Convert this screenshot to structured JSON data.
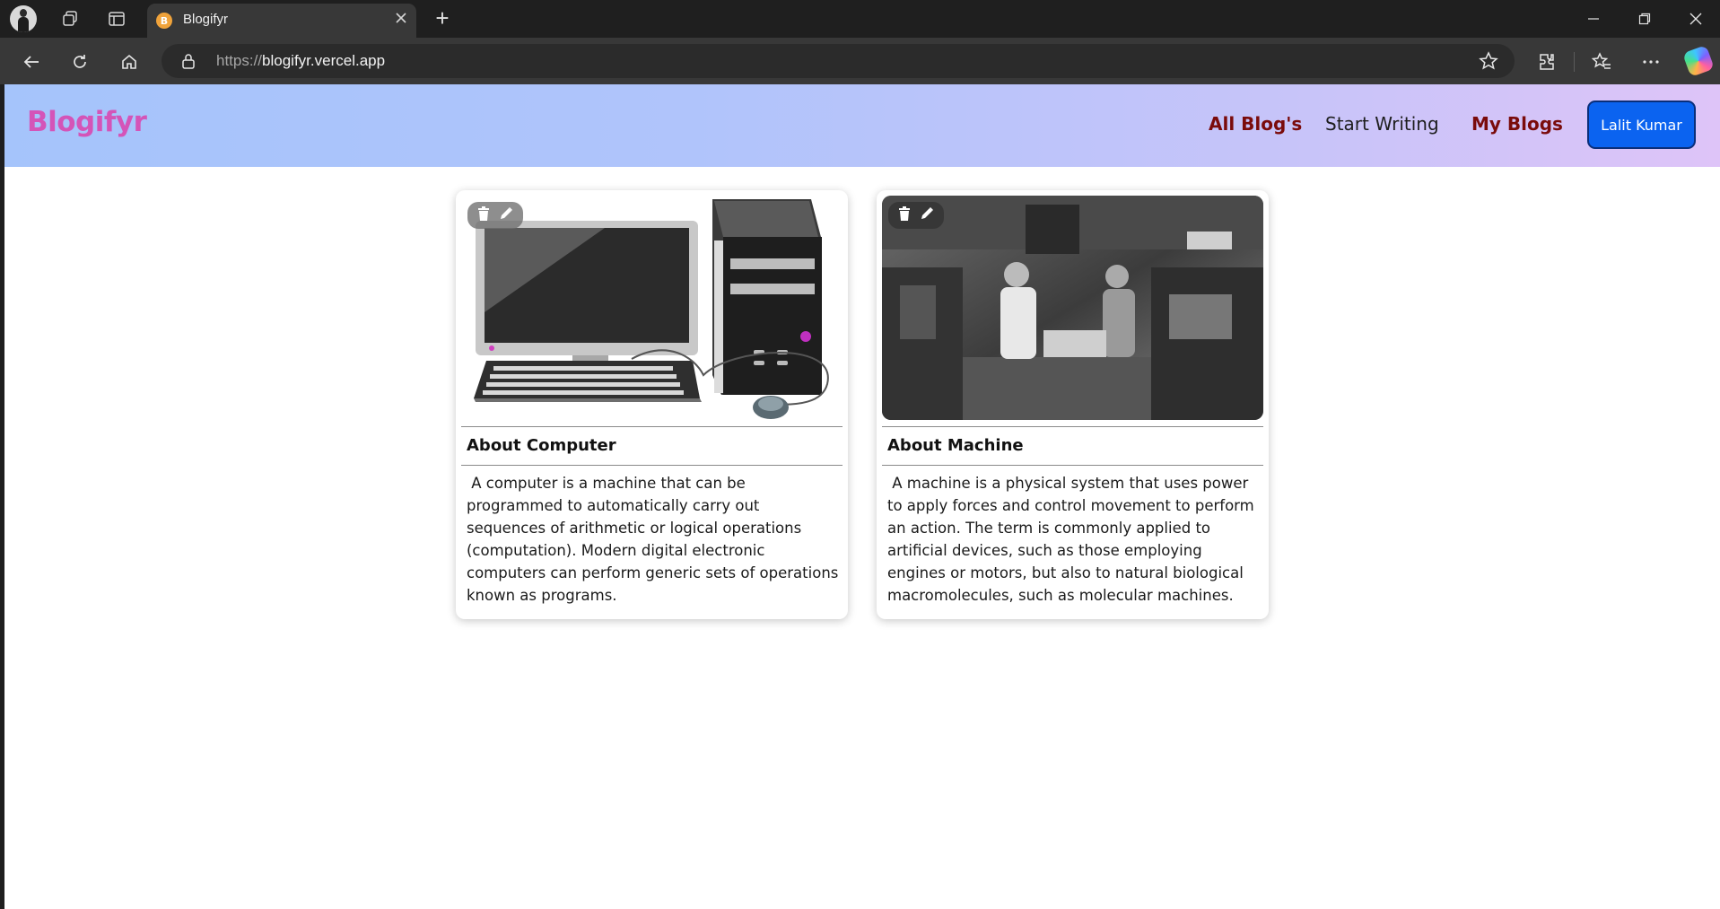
{
  "browser": {
    "tab_title": "Blogifyr",
    "tab_favicon_letter": "B",
    "url_scheme": "https://",
    "url_host": "blogifyr.vercel.app"
  },
  "site": {
    "brand": "Blogifyr",
    "nav": {
      "all_blogs": "All Blog's",
      "start_writing": "Start Writing",
      "my_blogs": "My Blogs"
    },
    "user_name": "Lalit Kumar"
  },
  "posts": [
    {
      "title": "About Computer",
      "body": " A computer is a machine that can be programmed to automatically carry out sequences of arithmetic or logical operations (computation). Modern digital electronic computers can perform generic sets of operations known as programs.",
      "image": "desktop-computer-illustration"
    },
    {
      "title": "About Machine",
      "body": " A machine is a physical system that uses power to apply forces and control movement to perform an action. The term is commonly applied to artificial devices, such as those employing engines or motors, but also to natural biological macromolecules, such as molecular machines.",
      "image": "factory-workers-photo"
    }
  ],
  "colors": {
    "brand": "#d454b8",
    "nav_accent": "#7a0b0b",
    "user_button": "#0b63f0"
  },
  "icons": [
    "trash-icon",
    "pencil-icon",
    "lock-icon",
    "star-icon",
    "back-icon",
    "refresh-icon",
    "home-icon"
  ]
}
